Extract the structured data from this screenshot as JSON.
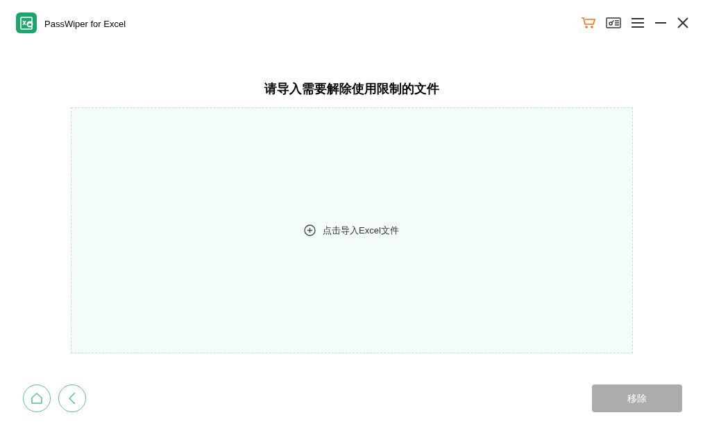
{
  "window": {
    "title": "PassWiper for Excel"
  },
  "heading": "请导入需要解除使用限制的文件",
  "dropzone": {
    "label": "点击导入Excel文件"
  },
  "remove_button": {
    "label": "移除",
    "disabled": true
  }
}
